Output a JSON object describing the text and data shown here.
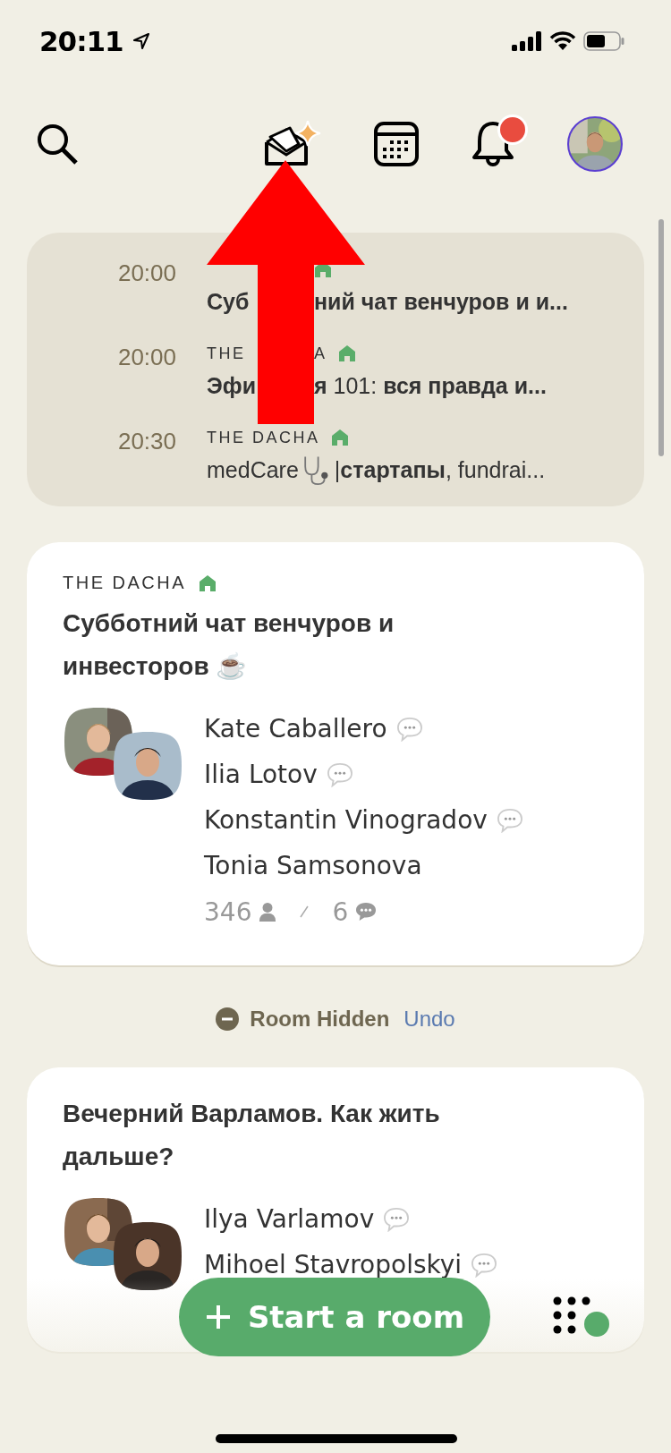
{
  "status_bar": {
    "time": "20:11"
  },
  "top_bar": {
    "notifications_unread": true
  },
  "upcoming": [
    {
      "time": "20:00",
      "covered": true,
      "title": [
        "**Суб**",
        "**ний чат венчуров и и...**"
      ]
    },
    {
      "time": "20:00",
      "covered": true,
      "club": [
        "THE",
        "A"
      ],
      "title": [
        "**Эфи**",
        "**я** 101: **вся правда и...**"
      ]
    },
    {
      "time": "20:30",
      "covered": false,
      "club": [
        "THE DACHA"
      ],
      "title": [
        "medCare",
        "|**стартапы**, fundrai..."
      ]
    }
  ],
  "rooms": [
    {
      "club": "THE DACHA",
      "title": "Субботний чат венчуров и инвесторов ☕",
      "speakers": [
        {
          "name": "Kate Caballero",
          "speaking": true
        },
        {
          "name": "Ilia Lotov",
          "speaking": true
        },
        {
          "name": "Konstantin Vinogradov",
          "speaking": true
        },
        {
          "name": "Tonia Samsonova",
          "speaking": false
        }
      ],
      "listeners": "346",
      "speakers_count": "6"
    },
    {
      "title": "Вечерний Варламов. Как жить дальше?",
      "speakers": [
        {
          "name": "Ilya Varlamov",
          "speaking": true
        },
        {
          "name": "Mihoel Stavropolskyi",
          "speaking": true
        }
      ]
    }
  ],
  "hidden_notice": {
    "label": "Room Hidden",
    "action": "Undo"
  },
  "start_button": {
    "label": "Start a room"
  },
  "annotation": {
    "kind": "arrow"
  }
}
